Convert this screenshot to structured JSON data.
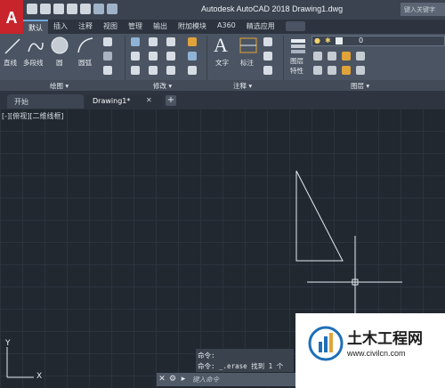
{
  "app": {
    "logo_letter": "A",
    "title": "Autodesk AutoCAD 2018    Drawing1.dwg",
    "search_placeholder": "键入关键字"
  },
  "ribbon_tabs": [
    "默认",
    "插入",
    "注释",
    "视图",
    "管理",
    "输出",
    "附加模块",
    "A360",
    "精选应用"
  ],
  "ribbon": {
    "draw": {
      "line": "直线",
      "polyline": "多段线",
      "circle": "圆",
      "arc": "圆弧",
      "panel_title": "绘图 ▾"
    },
    "modify": {
      "panel_title": "修改 ▾"
    },
    "annotation": {
      "text": "文字",
      "dimension": "标注",
      "panel_title": "注释 ▾"
    },
    "layers": {
      "layer_props_line1": "图层",
      "layer_props_line2": "特性",
      "current_layer": "0",
      "panel_title": "图层 ▾"
    }
  },
  "doc_tabs": {
    "start": "开始",
    "drawing": "Drawing1*"
  },
  "viewport_label": "[-][俯视][二维线框]",
  "ucs": {
    "x": "X",
    "y": "Y"
  },
  "command": {
    "history1": "命令:",
    "history2": "命令: _.erase 找到 1 个",
    "placeholder": "键入命令"
  },
  "watermark": {
    "title": "土木工程网",
    "url": "www.civilcn.com"
  },
  "colors": {
    "accent": "#c7242b",
    "canvas": "#212830",
    "ribbon": "#4b5462"
  }
}
